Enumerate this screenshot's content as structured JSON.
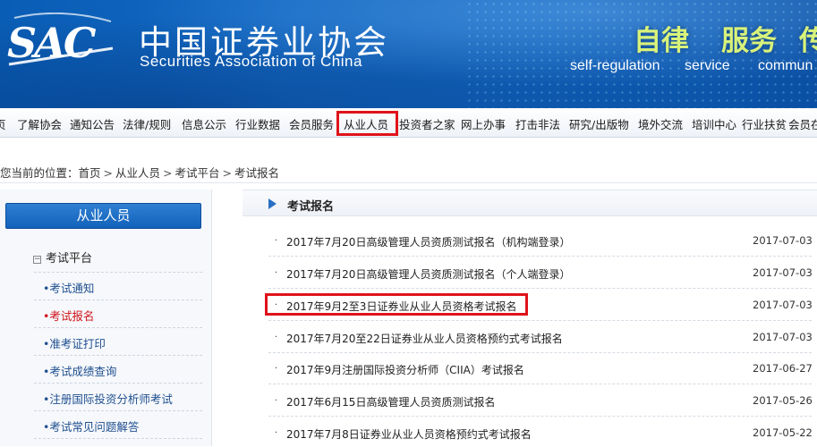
{
  "header": {
    "logo_text": "SAC",
    "org_name_cn": "中国证券业协会",
    "org_name_en": "Securities Association of China",
    "slogans": [
      {
        "cn": "自律",
        "en": "self-regulation"
      },
      {
        "cn": "服务",
        "en": "service"
      },
      {
        "cn": "传",
        "en": "commun"
      }
    ],
    "colors": {
      "banner": "#1267c1",
      "slogan": "#d8f27a"
    }
  },
  "nav": {
    "items": [
      "页",
      "了解协会",
      "通知公告",
      "法律/规则",
      "信息公示",
      "行业数据",
      "会员服务",
      "从业人员",
      "投资者之家",
      "网上办事",
      "打击非法",
      "研究/出版物",
      "境外交流",
      "培训中心",
      "行业扶贫",
      "会员在"
    ],
    "active_item": "从业人员",
    "highlight_color": "#e0131b"
  },
  "breadcrumb": {
    "prefix": "您当前的位置：",
    "items": [
      "首页",
      "从业人员",
      "考试平台",
      "考试报名"
    ],
    "separator": ">"
  },
  "sidebar": {
    "title": "从业人员",
    "group": {
      "expander": "−",
      "label": "考试平台"
    },
    "links": [
      {
        "label": "考试通知",
        "active": false
      },
      {
        "label": "考试报名",
        "active": true
      },
      {
        "label": "准考证打印",
        "active": false
      },
      {
        "label": "考试成绩查询",
        "active": false
      },
      {
        "label": "注册国际投资分析师考试",
        "active": false
      },
      {
        "label": "考试常见问题解答",
        "active": false
      }
    ],
    "link_bullet": "•"
  },
  "content": {
    "heading": "考试报名",
    "bullet": "·",
    "rows": [
      {
        "title": "2017年7月20日高级管理人员资质测试报名（机构端登录）",
        "date": "2017-07-03"
      },
      {
        "title": "2017年7月20日高级管理人员资质测试报名（个人端登录）",
        "date": "2017-07-03"
      },
      {
        "title": "2017年9月2至3日证券业从业人员资格考试报名",
        "date": "2017-07-03"
      },
      {
        "title": "2017年7月20至22日证券业从业人员资格预约式考试报名",
        "date": "2017-07-03"
      },
      {
        "title": "2017年9月注册国际投资分析师（CIIA）考试报名",
        "date": "2017-06-27"
      },
      {
        "title": "2017年6月15日高级管理人员资质测试报名",
        "date": "2017-05-26"
      },
      {
        "title": "2017年7月8日证券业从业人员资格预约式考试报名",
        "date": "2017-05-22"
      }
    ],
    "highlighted_row": "2017年9月2至3日证券业从业人员资格考试报名"
  }
}
